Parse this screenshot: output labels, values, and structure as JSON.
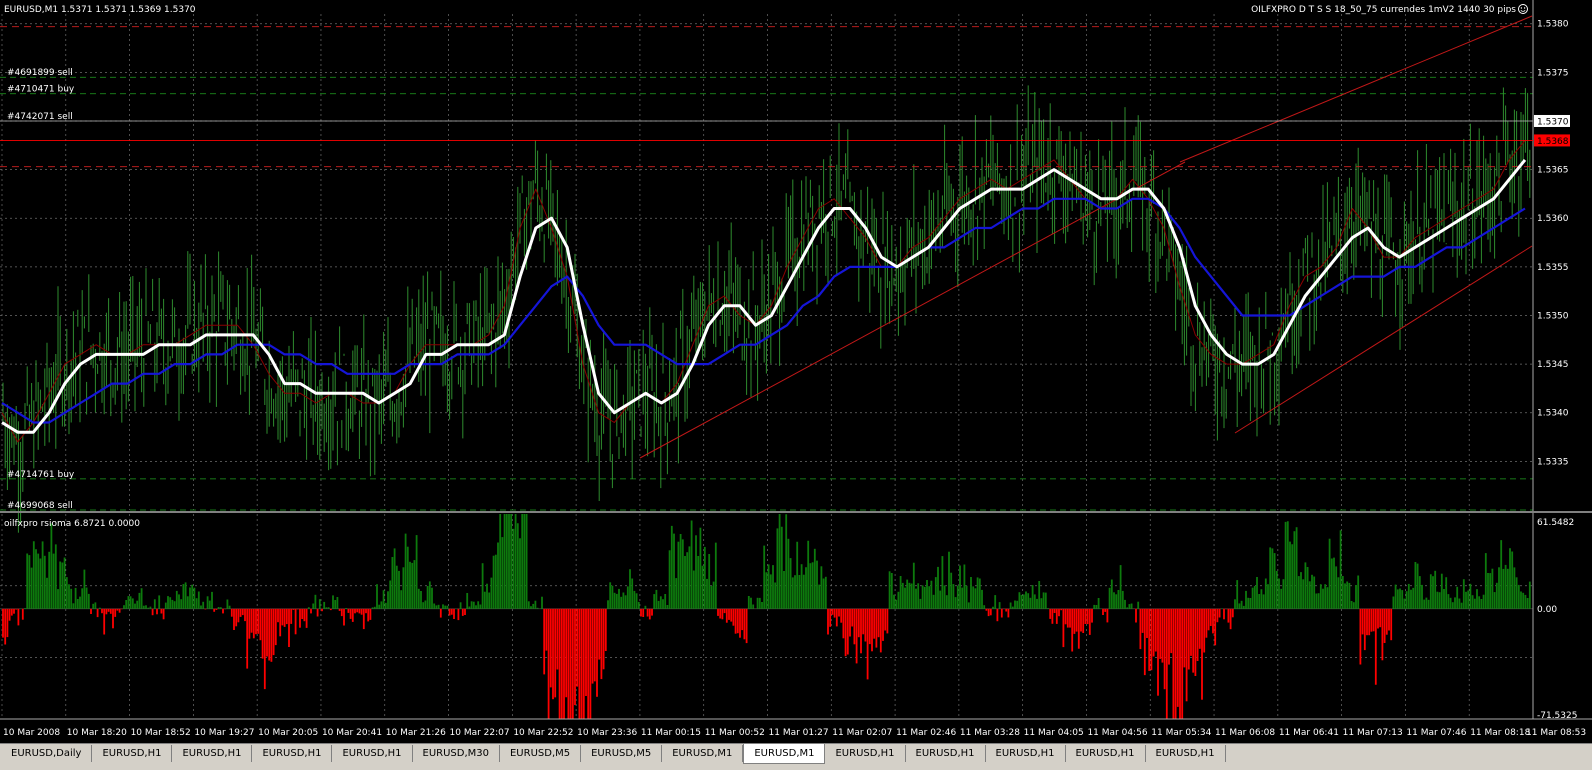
{
  "main_header": {
    "symbol_info": "EURUSD,M1  1.5371 1.5371 1.5369 1.5370",
    "expert_info": "OILFXPRO D T S S 18_50_75 currendes 1mV2 1440 30 pips"
  },
  "sub_header": {
    "indicator_info": "oilfxpro rsioma 6.8721 0.0000"
  },
  "chart_data": [
    {
      "type": "line",
      "title": "EURUSD,M1",
      "ylim": [
        1.533,
        1.5381
      ],
      "yticks": [
        "1.5380",
        "1.5375",
        "1.5370",
        "1.5365",
        "1.5360",
        "1.5355",
        "1.5350",
        "1.5345",
        "1.5340",
        "1.5335"
      ],
      "current_price": "1.5370",
      "current_ask": "1.5368",
      "x_labels": [
        "10 Mar 2008",
        "10 Mar 18:20",
        "10 Mar 18:52",
        "10 Mar 19:27",
        "10 Mar 20:05",
        "10 Mar 20:41",
        "10 Mar 21:26",
        "10 Mar 22:07",
        "10 Mar 22:52",
        "10 Mar 23:36",
        "11 Mar 00:15",
        "11 Mar 00:52",
        "11 Mar 01:27",
        "11 Mar 02:07",
        "11 Mar 02:46",
        "11 Mar 03:28",
        "11 Mar 04:05",
        "11 Mar 04:56",
        "11 Mar 05:34",
        "11 Mar 06:08",
        "11 Mar 06:41",
        "11 Mar 07:13",
        "11 Mar 07:46",
        "11 Mar 08:18",
        "11 Mar 08:53"
      ],
      "orders": [
        {
          "label": "#4691899 sell",
          "price": 1.53745
        },
        {
          "label": "#4710471 buy",
          "price": 1.53728
        },
        {
          "label": "#4742071 sell",
          "price": 1.537
        },
        {
          "label": "#4714761 buy",
          "price": 1.53332
        },
        {
          "label": "#4699068 sell",
          "price": 1.533
        }
      ],
      "series": [
        {
          "color": "#ffffff",
          "values": [
            1.5339,
            1.5338,
            1.5338,
            1.534,
            1.5343,
            1.5345,
            1.5346,
            1.5346,
            1.5346,
            1.5346,
            1.5347,
            1.5347,
            1.5347,
            1.5348,
            1.5348,
            1.5348,
            1.5348,
            1.5346,
            1.5343,
            1.5343,
            1.5342,
            1.5342,
            1.5342,
            1.5342,
            1.5341,
            1.5342,
            1.5343,
            1.5346,
            1.5346,
            1.5347,
            1.5347,
            1.5347,
            1.5348,
            1.5354,
            1.5359,
            1.536,
            1.5357,
            1.5349,
            1.5342,
            1.534,
            1.5341,
            1.5342,
            1.5341,
            1.5342,
            1.5345,
            1.5349,
            1.5351,
            1.5351,
            1.5349,
            1.535,
            1.5353,
            1.5356,
            1.5359,
            1.5361,
            1.5361,
            1.5359,
            1.5356,
            1.5355,
            1.5356,
            1.5357,
            1.5359,
            1.5361,
            1.5362,
            1.5363,
            1.5363,
            1.5363,
            1.5364,
            1.5365,
            1.5364,
            1.5363,
            1.5362,
            1.5362,
            1.5363,
            1.5363,
            1.5361,
            1.5357,
            1.5351,
            1.5348,
            1.5346,
            1.5345,
            1.5345,
            1.5346,
            1.5349,
            1.5352,
            1.5354,
            1.5356,
            1.5358,
            1.5359,
            1.5357,
            1.5356,
            1.5357,
            1.5358,
            1.5359,
            1.536,
            1.5361,
            1.5362,
            1.5364,
            1.5366
          ]
        },
        {
          "color": "#8b0000",
          "values": [
            1.534,
            1.5337,
            1.5339,
            1.5342,
            1.5345,
            1.5346,
            1.5347,
            1.5346,
            1.5346,
            1.5347,
            1.5347,
            1.5347,
            1.5348,
            1.5349,
            1.5349,
            1.5349,
            1.5347,
            1.5344,
            1.5342,
            1.5342,
            1.5341,
            1.5342,
            1.5342,
            1.5341,
            1.5341,
            1.5342,
            1.5345,
            1.5347,
            1.5347,
            1.5347,
            1.5347,
            1.5348,
            1.5351,
            1.5359,
            1.5363,
            1.5359,
            1.5354,
            1.5345,
            1.534,
            1.5339,
            1.5341,
            1.5342,
            1.5341,
            1.5343,
            1.5347,
            1.5351,
            1.5352,
            1.535,
            1.5349,
            1.5351,
            1.5355,
            1.5358,
            1.5361,
            1.5362,
            1.536,
            1.5358,
            1.5355,
            1.5355,
            1.5357,
            1.5358,
            1.536,
            1.5362,
            1.5363,
            1.5364,
            1.5363,
            1.5364,
            1.5365,
            1.5366,
            1.5364,
            1.5362,
            1.5361,
            1.5362,
            1.5364,
            1.5362,
            1.5359,
            1.5353,
            1.5348,
            1.5346,
            1.5345,
            1.5345,
            1.5346,
            1.5347,
            1.5351,
            1.5354,
            1.5355,
            1.5357,
            1.5361,
            1.5359,
            1.5356,
            1.5356,
            1.5358,
            1.5359,
            1.536,
            1.5361,
            1.5362,
            1.5363,
            1.5366,
            1.5368
          ]
        },
        {
          "color": "#1515d8",
          "values": [
            1.5341,
            1.534,
            1.5339,
            1.5339,
            1.534,
            1.5341,
            1.5342,
            1.5343,
            1.5343,
            1.5344,
            1.5344,
            1.5345,
            1.5345,
            1.5346,
            1.5346,
            1.5347,
            1.5347,
            1.5347,
            1.5346,
            1.5346,
            1.5345,
            1.5345,
            1.5344,
            1.5344,
            1.5344,
            1.5344,
            1.5345,
            1.5345,
            1.5345,
            1.5346,
            1.5346,
            1.5346,
            1.5347,
            1.5349,
            1.5351,
            1.5353,
            1.5354,
            1.5352,
            1.5349,
            1.5347,
            1.5347,
            1.5347,
            1.5346,
            1.5345,
            1.5345,
            1.5345,
            1.5346,
            1.5347,
            1.5347,
            1.5348,
            1.5349,
            1.5351,
            1.5352,
            1.5354,
            1.5355,
            1.5355,
            1.5355,
            1.5355,
            1.5356,
            1.5357,
            1.5357,
            1.5358,
            1.5359,
            1.5359,
            1.536,
            1.5361,
            1.5361,
            1.5362,
            1.5362,
            1.5362,
            1.5361,
            1.5361,
            1.5362,
            1.5362,
            1.5361,
            1.5359,
            1.5356,
            1.5354,
            1.5352,
            1.535,
            1.535,
            1.535,
            1.535,
            1.5351,
            1.5352,
            1.5353,
            1.5354,
            1.5354,
            1.5354,
            1.5355,
            1.5355,
            1.5356,
            1.5357,
            1.5357,
            1.5358,
            1.5359,
            1.536,
            1.5361
          ]
        }
      ]
    },
    {
      "type": "bar",
      "title": "oilfxpro rsioma 6.8721 0.0000",
      "ylim": [
        -71.5325,
        61.5482
      ],
      "yticks": [
        "61.5482",
        "0.00",
        "-71.5325"
      ]
    }
  ],
  "tabs": [
    "EURUSD,Daily",
    "EURUSD,H1",
    "EURUSD,H1",
    "EURUSD,H1",
    "EURUSD,H1",
    "EURUSD,M30",
    "EURUSD,M5",
    "EURUSD,M5",
    "EURUSD,M1",
    "EURUSD,M1",
    "EURUSD,H1",
    "EURUSD,H1",
    "EURUSD,H1",
    "EURUSD,H1",
    "EURUSD,H1"
  ],
  "active_tab": 9,
  "colors": {
    "bars": "#2e8b2e",
    "grid": "#6e6e6e",
    "positive": "#0d7a0d",
    "negative": "#ff0000",
    "trendline": "#c01818",
    "ask_box": "#ff0000"
  }
}
